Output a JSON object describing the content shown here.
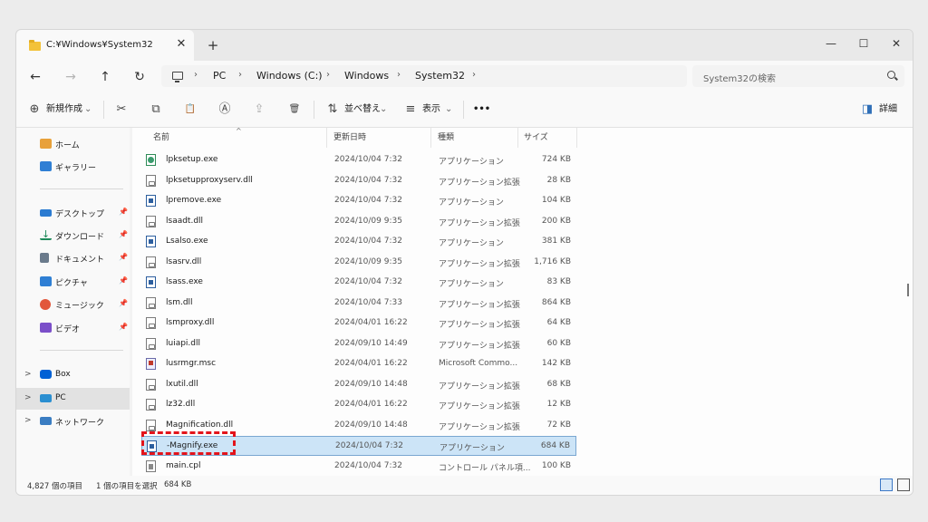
{
  "window": {
    "tab_title": "C:¥Windows¥System32",
    "tab_close": "✕",
    "tab_add": "+",
    "minimize": "—",
    "maximize": "☐",
    "close": "✕"
  },
  "addressbar": {
    "back": "←",
    "forward": "→",
    "up": "↑",
    "refresh": "↻",
    "breadcrumb": [
      "PC",
      "Windows (C:)",
      "Windows",
      "System32"
    ],
    "chevron": "›",
    "search_placeholder": "System32の検索"
  },
  "toolbar": {
    "new_label": "新規作成",
    "new_icon": "⊕",
    "cut_icon": "✂",
    "copy_icon": "⧉",
    "paste_icon": "📋",
    "rename_icon": "Ⓐ",
    "share_icon": "⇪",
    "delete_icon": "🗑",
    "sort_label": "並べ替え",
    "sort_icon": "⇅",
    "view_label": "表示",
    "view_icon": "≡",
    "more_label": "•••",
    "details_label": "詳細",
    "details_icon": "◨",
    "dropdown": "⌄"
  },
  "sidebar": {
    "quick": [
      {
        "label": "ホーム",
        "icon": "home-icon",
        "color": "#e8a13a"
      },
      {
        "label": "ギャラリー",
        "icon": "gallery-icon",
        "color": "#2f7fd4"
      }
    ],
    "pinned": [
      {
        "label": "デスクトップ",
        "icon": "desktop-icon",
        "color": "#2b7bd1"
      },
      {
        "label": "ダウンロード",
        "icon": "download-icon",
        "color": "#1e8a5a"
      },
      {
        "label": "ドキュメント",
        "icon": "document-icon",
        "color": "#6b7b8c"
      },
      {
        "label": "ピクチャ",
        "icon": "pictures-icon",
        "color": "#2f7fd4"
      },
      {
        "label": "ミュージック",
        "icon": "music-icon",
        "color": "#e2573b"
      },
      {
        "label": "ビデオ",
        "icon": "video-icon",
        "color": "#7b4fc9"
      }
    ],
    "pin_glyph": "📌",
    "drives": [
      {
        "label": "Box",
        "icon": "box-icon",
        "color": "#0061d5"
      },
      {
        "label": "PC",
        "icon": "pc-icon",
        "color": "#2b8fd1"
      },
      {
        "label": "ネットワーク",
        "icon": "network-icon",
        "color": "#3a7dc2"
      }
    ],
    "expand_glyph": ">"
  },
  "filelist": {
    "columns": {
      "name": "名前",
      "date": "更新日時",
      "type": "種類",
      "size": "サイズ"
    },
    "sort_arrow": "^",
    "rows": [
      {
        "name": "lpksetup.exe",
        "date": "2024/10/04 7:32",
        "type": "アプリケーション",
        "size": "724 KB",
        "kind": "setup"
      },
      {
        "name": "lpksetupproxyserv.dll",
        "date": "2024/10/04 7:32",
        "type": "アプリケーション拡張",
        "size": "28 KB",
        "kind": "dll"
      },
      {
        "name": "lpremove.exe",
        "date": "2024/10/04 7:32",
        "type": "アプリケーション",
        "size": "104 KB",
        "kind": "exe"
      },
      {
        "name": "lsaadt.dll",
        "date": "2024/10/09 9:35",
        "type": "アプリケーション拡張",
        "size": "200 KB",
        "kind": "dll"
      },
      {
        "name": "Lsalso.exe",
        "date": "2024/10/04 7:32",
        "type": "アプリケーション",
        "size": "381 KB",
        "kind": "exe"
      },
      {
        "name": "lsasrv.dll",
        "date": "2024/10/09 9:35",
        "type": "アプリケーション拡張",
        "size": "1,716 KB",
        "kind": "dll"
      },
      {
        "name": "lsass.exe",
        "date": "2024/10/04 7:32",
        "type": "アプリケーション",
        "size": "83 KB",
        "kind": "exe"
      },
      {
        "name": "lsm.dll",
        "date": "2024/10/04 7:33",
        "type": "アプリケーション拡張",
        "size": "864 KB",
        "kind": "dll"
      },
      {
        "name": "lsmproxy.dll",
        "date": "2024/04/01 16:22",
        "type": "アプリケーション拡張",
        "size": "64 KB",
        "kind": "dll"
      },
      {
        "name": "luiapi.dll",
        "date": "2024/09/10 14:49",
        "type": "アプリケーション拡張",
        "size": "60 KB",
        "kind": "dll"
      },
      {
        "name": "lusrmgr.msc",
        "date": "2024/04/01 16:22",
        "type": "Microsoft Commo...",
        "size": "142 KB",
        "kind": "msc"
      },
      {
        "name": "lxutil.dll",
        "date": "2024/09/10 14:48",
        "type": "アプリケーション拡張",
        "size": "68 KB",
        "kind": "dll"
      },
      {
        "name": "lz32.dll",
        "date": "2024/04/01 16:22",
        "type": "アプリケーション拡張",
        "size": "12 KB",
        "kind": "dll"
      },
      {
        "name": "Magnification.dll",
        "date": "2024/09/10 14:48",
        "type": "アプリケーション拡張",
        "size": "72 KB",
        "kind": "dll"
      },
      {
        "name": "-Magnify.exe",
        "date": "2024/10/04 7:32",
        "type": "アプリケーション",
        "size": "684 KB",
        "kind": "exe",
        "selected": true
      },
      {
        "name": "main.cpl",
        "date": "2024/10/04 7:32",
        "type": "コントロール パネル項...",
        "size": "100 KB",
        "kind": "cpl"
      }
    ]
  },
  "statusbar": {
    "item_count": "4,827 個の項目",
    "selection": "1 個の項目を選択",
    "selection_size": "684 KB"
  },
  "colors": {
    "selection_bg": "#cce4f7",
    "highlight_border": "#e3141b",
    "folder": "#f3c23a"
  }
}
